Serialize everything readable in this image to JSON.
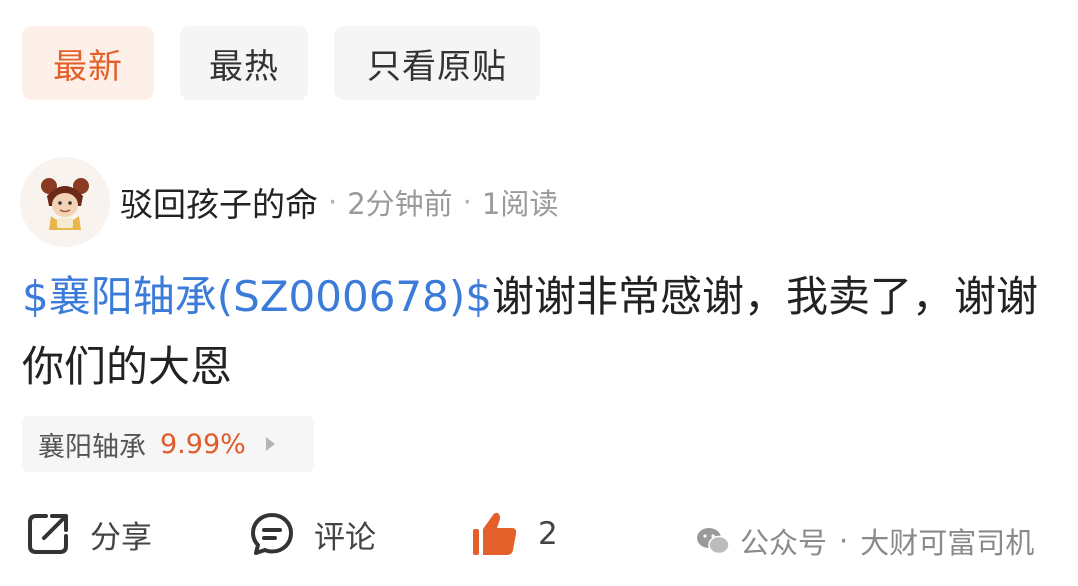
{
  "tabs": [
    {
      "label": "最新",
      "active": true
    },
    {
      "label": "最热",
      "active": false
    },
    {
      "label": "只看原贴",
      "active": false
    }
  ],
  "post": {
    "username": "驳回孩子的命",
    "time": "2分钟前",
    "reads": "1阅读",
    "separator": "·",
    "stock_tag": "$襄阳轴承(SZ000678)$",
    "text": "谢谢非常感谢，我卖了，谢谢你们的大恩"
  },
  "stock_chip": {
    "name": "襄阳轴承",
    "change": "9.99%"
  },
  "actions": {
    "share_label": "分享",
    "comment_label": "评论",
    "like_count": "2"
  },
  "watermark": {
    "account": "公众号",
    "separator": "·",
    "name": "大财可富司机"
  },
  "colors": {
    "accent": "#e4602a",
    "link": "#3b7bd9",
    "tab_active_bg": "#fdf0e9",
    "tab_bg": "#f5f5f5",
    "meta": "#9a9a9a"
  }
}
